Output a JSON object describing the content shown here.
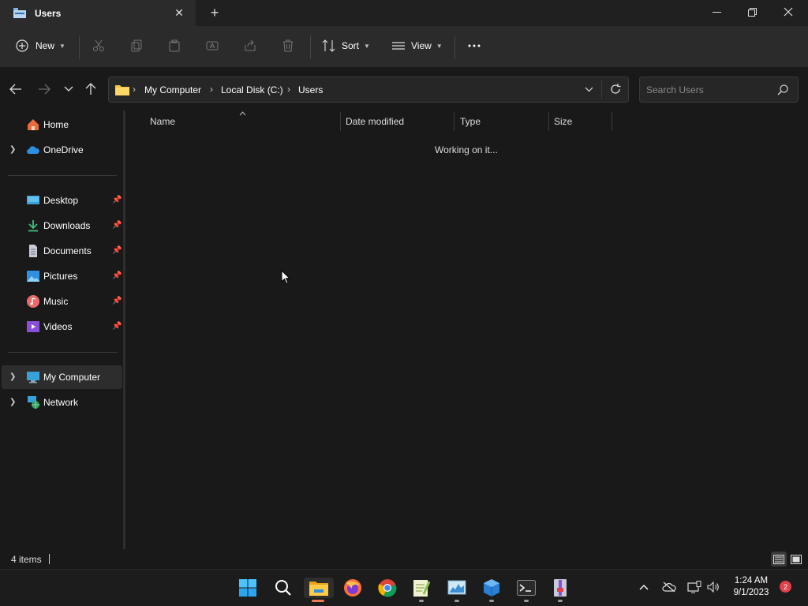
{
  "window": {
    "tab_title": "Users"
  },
  "toolbar": {
    "new_label": "New",
    "sort_label": "Sort",
    "view_label": "View"
  },
  "address": {
    "crumbs": [
      "My Computer",
      "Local Disk (C:)",
      "Users"
    ],
    "search_placeholder": "Search Users"
  },
  "sidebar": {
    "top": [
      {
        "label": "Home",
        "icon": "home-icon"
      },
      {
        "label": "OneDrive",
        "icon": "onedrive-icon"
      }
    ],
    "pinned": [
      {
        "label": "Desktop",
        "icon": "desktop-icon"
      },
      {
        "label": "Downloads",
        "icon": "downloads-icon"
      },
      {
        "label": "Documents",
        "icon": "documents-icon"
      },
      {
        "label": "Pictures",
        "icon": "pictures-icon"
      },
      {
        "label": "Music",
        "icon": "music-icon"
      },
      {
        "label": "Videos",
        "icon": "videos-icon"
      }
    ],
    "bottom": [
      {
        "label": "My Computer",
        "icon": "computer-icon",
        "selected": true
      },
      {
        "label": "Network",
        "icon": "network-icon"
      }
    ]
  },
  "columns": [
    "Name",
    "Date modified",
    "Type",
    "Size"
  ],
  "content": {
    "status_message": "Working on it..."
  },
  "statusbar": {
    "item_count": "4 items"
  },
  "taskbar": {
    "time": "1:24 AM",
    "date": "9/1/2023",
    "notification_count": "2"
  },
  "colors": {
    "accent": "#0078d4",
    "folder": "#f6c443",
    "badge": "#e0414a"
  }
}
